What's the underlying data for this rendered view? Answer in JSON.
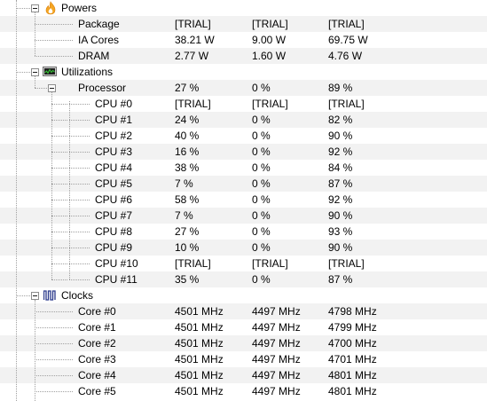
{
  "groups": {
    "powers": {
      "label": "Powers",
      "icon": "flame-icon",
      "rows": [
        {
          "label": "Package",
          "current": "[TRIAL]",
          "min": "[TRIAL]",
          "max": "[TRIAL]"
        },
        {
          "label": "IA Cores",
          "current": "38.21 W",
          "min": "9.00 W",
          "max": "69.75 W"
        },
        {
          "label": "DRAM",
          "current": "2.77 W",
          "min": "1.60 W",
          "max": "4.76 W"
        }
      ]
    },
    "utilizations": {
      "label": "Utilizations",
      "icon": "monitor-graph-icon",
      "processor": {
        "label": "Processor",
        "current": "27 %",
        "min": "0 %",
        "max": "89 %"
      },
      "rows": [
        {
          "label": "CPU #0",
          "current": "[TRIAL]",
          "min": "[TRIAL]",
          "max": "[TRIAL]"
        },
        {
          "label": "CPU #1",
          "current": "24 %",
          "min": "0 %",
          "max": "82 %"
        },
        {
          "label": "CPU #2",
          "current": "40 %",
          "min": "0 %",
          "max": "90 %"
        },
        {
          "label": "CPU #3",
          "current": "16 %",
          "min": "0 %",
          "max": "92 %"
        },
        {
          "label": "CPU #4",
          "current": "38 %",
          "min": "0 %",
          "max": "84 %"
        },
        {
          "label": "CPU #5",
          "current": "7 %",
          "min": "0 %",
          "max": "87 %"
        },
        {
          "label": "CPU #6",
          "current": "58 %",
          "min": "0 %",
          "max": "92 %"
        },
        {
          "label": "CPU #7",
          "current": "7 %",
          "min": "0 %",
          "max": "90 %"
        },
        {
          "label": "CPU #8",
          "current": "27 %",
          "min": "0 %",
          "max": "93 %"
        },
        {
          "label": "CPU #9",
          "current": "10 %",
          "min": "0 %",
          "max": "90 %"
        },
        {
          "label": "CPU #10",
          "current": "[TRIAL]",
          "min": "[TRIAL]",
          "max": "[TRIAL]"
        },
        {
          "label": "CPU #11",
          "current": "35 %",
          "min": "0 %",
          "max": "87 %"
        }
      ]
    },
    "clocks": {
      "label": "Clocks",
      "icon": "clock-pulse-icon",
      "rows": [
        {
          "label": "Core #0",
          "current": "4501 MHz",
          "min": "4497 MHz",
          "max": "4798 MHz"
        },
        {
          "label": "Core #1",
          "current": "4501 MHz",
          "min": "4497 MHz",
          "max": "4799 MHz"
        },
        {
          "label": "Core #2",
          "current": "4501 MHz",
          "min": "4497 MHz",
          "max": "4700 MHz"
        },
        {
          "label": "Core #3",
          "current": "4501 MHz",
          "min": "4497 MHz",
          "max": "4701 MHz"
        },
        {
          "label": "Core #4",
          "current": "4501 MHz",
          "min": "4497 MHz",
          "max": "4801 MHz"
        },
        {
          "label": "Core #5",
          "current": "4501 MHz",
          "min": "4497 MHz",
          "max": "4801 MHz"
        }
      ]
    }
  },
  "colors": {
    "stripe": "#f2f2f2",
    "tree_line": "#a0a0a0",
    "flame_outer": "#f5a623",
    "flame_inner": "#ffffff",
    "monitor_screen": "#1f1f1f",
    "monitor_graph": "#33cc33",
    "clock_wave": "#2b3a8c"
  }
}
